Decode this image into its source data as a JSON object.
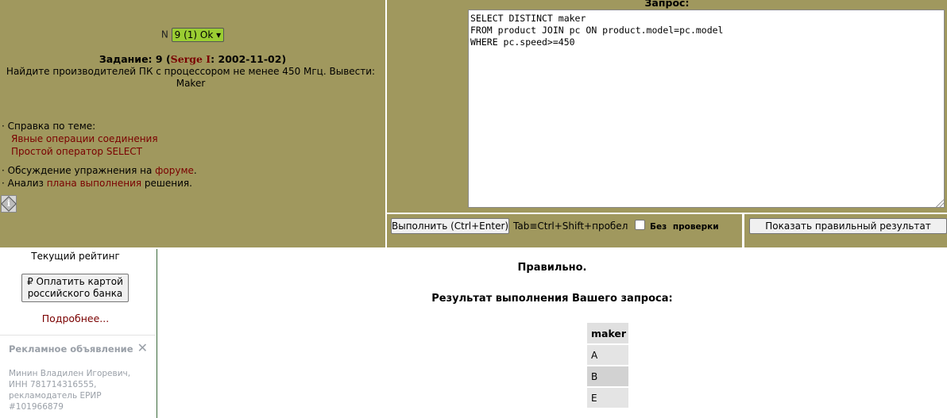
{
  "task": {
    "n_label": "N",
    "selected": "9 (1) Ok",
    "title_prefix": "Задание: 9 (",
    "author": "Serge I",
    "title_suffix": ": 2002-11-02)",
    "description": "Найдите производителей ПК с процессором не менее 450 Мгц. Вывести: Maker"
  },
  "help": {
    "heading": "· Справка по теме:",
    "links": [
      "Явные операции соединения",
      "Простой оператор SELECT"
    ],
    "forum_prefix": "· Обсуждение упражнения на ",
    "forum_link": "форуме",
    "forum_suffix": ".",
    "plan_prefix": "· Анализ ",
    "plan_link": "плана выполнения",
    "plan_suffix": " решения."
  },
  "query": {
    "label": "Запрос:",
    "text": "SELECT DISTINCT maker\nFROM product JOIN pc ON product.model=pc.model\nWHERE pc.speed>=450"
  },
  "toolbar": {
    "execute_label": "Выполнить (Ctrl+Enter)",
    "tab_hint": "Tab≡Ctrl+Shift+пробел",
    "no_check_label": "Без проверки",
    "no_check_checked": false,
    "show_correct_label": "Показать правильный результат"
  },
  "sidebar": {
    "rating_label": "Текущий рейтинг",
    "pay_button": "₽ Оплатить картой российского банка",
    "more_link": "Подробнее...",
    "ad": {
      "title": "Рекламное объявление",
      "close": "✕",
      "body": "Минин Владилен Игоревич, ИНН 781714316555, рекламодатель ЕРИР #101966879"
    }
  },
  "result": {
    "status": "Правильно.",
    "title": "Результат выполнения Вашего запроса:",
    "columns": [
      "maker"
    ],
    "rows": [
      "A",
      "B",
      "E"
    ]
  }
}
